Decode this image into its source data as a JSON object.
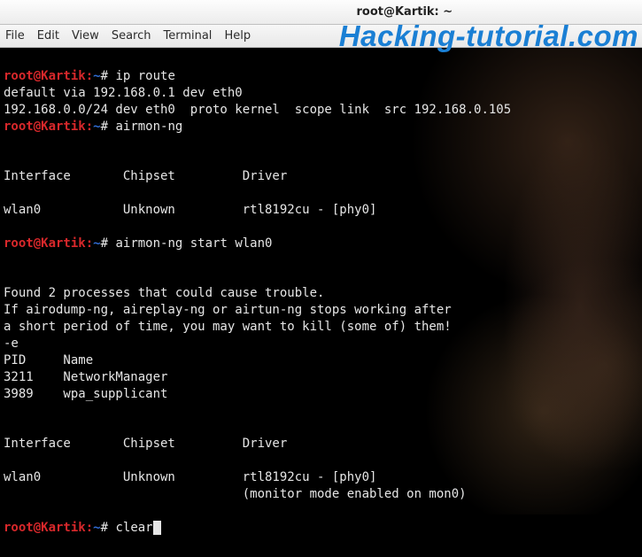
{
  "window": {
    "title": "root@Kartik: ~"
  },
  "menubar": {
    "items": [
      "File",
      "Edit",
      "View",
      "Search",
      "Terminal",
      "Help"
    ]
  },
  "watermark": "Hacking-tutorial.com",
  "prompt": {
    "user_host": "root@Kartik",
    "path": "~",
    "symbol": "#"
  },
  "commands": {
    "cmd1": "ip route",
    "cmd2": "airmon-ng",
    "cmd3": "airmon-ng start wlan0",
    "cmd4": "clear"
  },
  "output": {
    "iproute_l1": "default via 192.168.0.1 dev eth0",
    "iproute_l2": "192.168.0.0/24 dev eth0  proto kernel  scope link  src 192.168.0.105",
    "hdr1": "Interface       Chipset         Driver",
    "row1": "wlan0           Unknown         rtl8192cu - [phy0]",
    "found_l1": "Found 2 processes that could cause trouble.",
    "found_l2": "If airodump-ng, aireplay-ng or airtun-ng stops working after",
    "found_l3": "a short period of time, you may want to kill (some of) them!",
    "found_l4": "-e",
    "pid_hdr": "PID     Name",
    "pid_r1": "3211    NetworkManager",
    "pid_r2": "3989    wpa_supplicant",
    "hdr2": "Interface       Chipset         Driver",
    "row2a": "wlan0           Unknown         rtl8192cu - [phy0]",
    "row2b": "                                (monitor mode enabled on mon0)"
  }
}
